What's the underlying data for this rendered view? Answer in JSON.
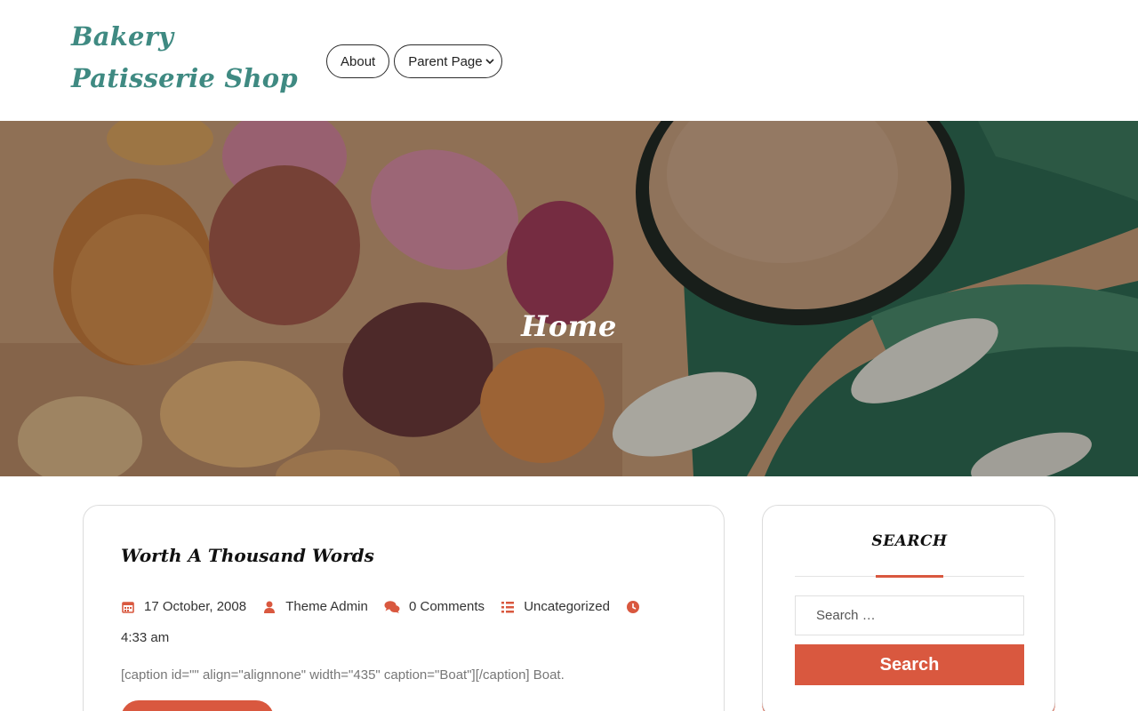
{
  "site": {
    "title": "Bakery Patisserie Shop"
  },
  "nav": {
    "items": [
      {
        "label": "About"
      },
      {
        "label": "Parent Page"
      }
    ]
  },
  "hero": {
    "title": "Home"
  },
  "post": {
    "title": "Worth A Thousand Words",
    "meta": {
      "date": "17 October, 2008",
      "author": "Theme Admin",
      "comments": "0 Comments",
      "category": "Uncategorized",
      "time": "4:33 am"
    },
    "excerpt": "[caption id=\"\" align=\"alignnone\" width=\"435\" caption=\"Boat\"][/caption] Boat."
  },
  "sidebar": {
    "search_widget": {
      "title": "SEARCH",
      "placeholder": "Search …",
      "button_label": "Search"
    }
  },
  "colors": {
    "accent": "#d9583f",
    "brand": "#3f8a82"
  },
  "icons": [
    "chevron-down-icon",
    "calendar-icon",
    "user-icon",
    "comments-icon",
    "list-icon",
    "clock-icon"
  ]
}
